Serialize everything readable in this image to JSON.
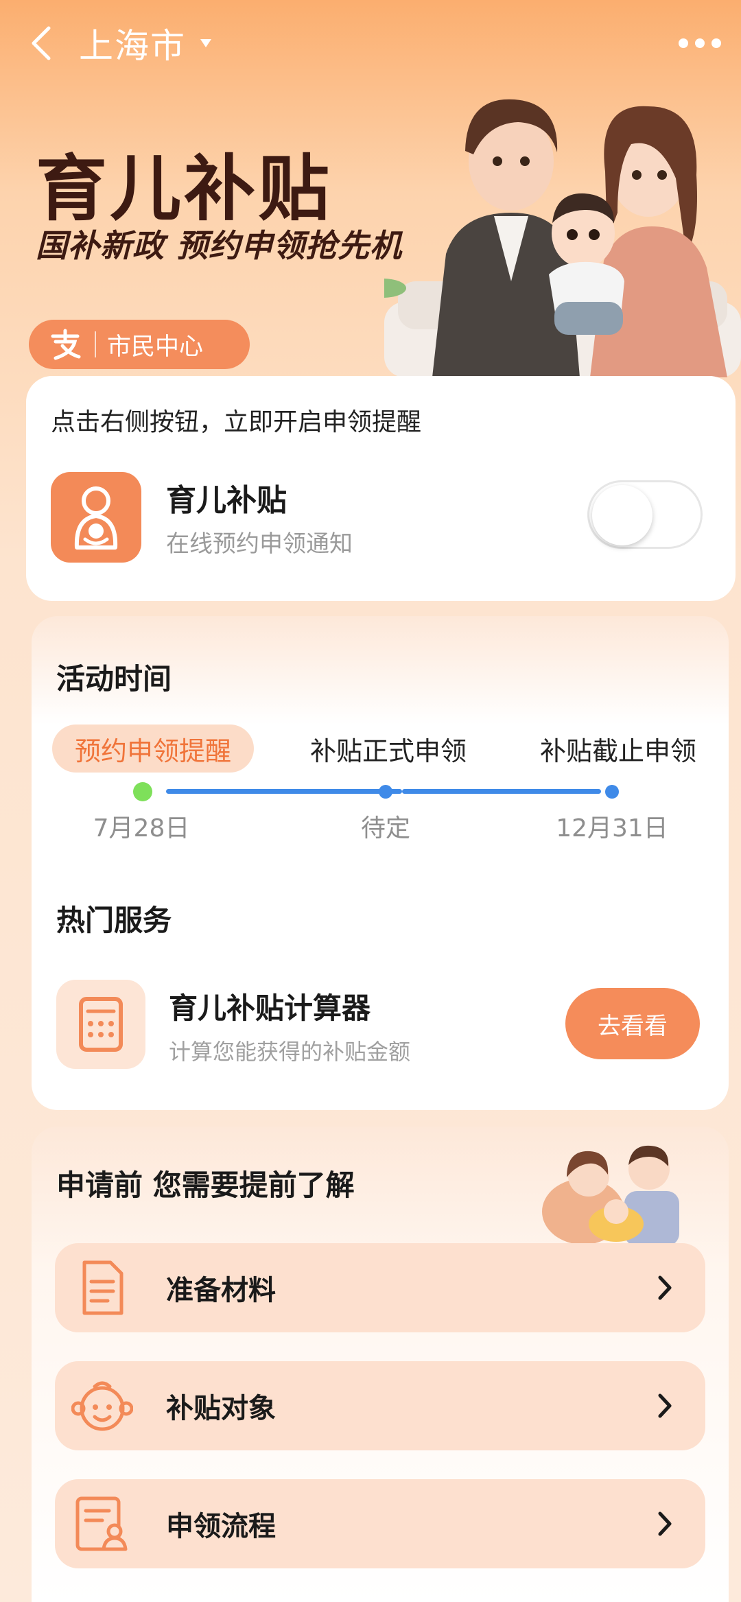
{
  "header": {
    "city": "上海市",
    "hero_title": "育儿补贴",
    "hero_subtitle": "国补新政 预约申领抢先机",
    "badge_text": "市民中心"
  },
  "reminder_card": {
    "hint": "点击右侧按钮，立即开启申领提醒",
    "title": "育儿补贴",
    "desc": "在线预约申领通知",
    "toggle_on": false
  },
  "activity": {
    "title": "活动时间",
    "stages": [
      {
        "label": "预约申领提醒",
        "date": "7月28日"
      },
      {
        "label": "补贴正式申领",
        "date": "待定"
      },
      {
        "label": "补贴截止申领",
        "date": "12月31日"
      }
    ],
    "hot_title": "热门服务",
    "calc_title": "育儿补贴计算器",
    "calc_desc": "计算您能获得的补贴金额",
    "calc_button": "去看看"
  },
  "info": {
    "title": "申请前 您需要提前了解",
    "items": [
      {
        "label": "准备材料",
        "icon": "document-icon"
      },
      {
        "label": "补贴对象",
        "icon": "baby-face-icon"
      },
      {
        "label": "申领流程",
        "icon": "process-form-icon"
      }
    ]
  },
  "colors": {
    "accent": "#f58c5a",
    "timeline_blue": "#3f8ae8",
    "timeline_green": "#7ee05a",
    "title_dark": "#3d1a12"
  }
}
